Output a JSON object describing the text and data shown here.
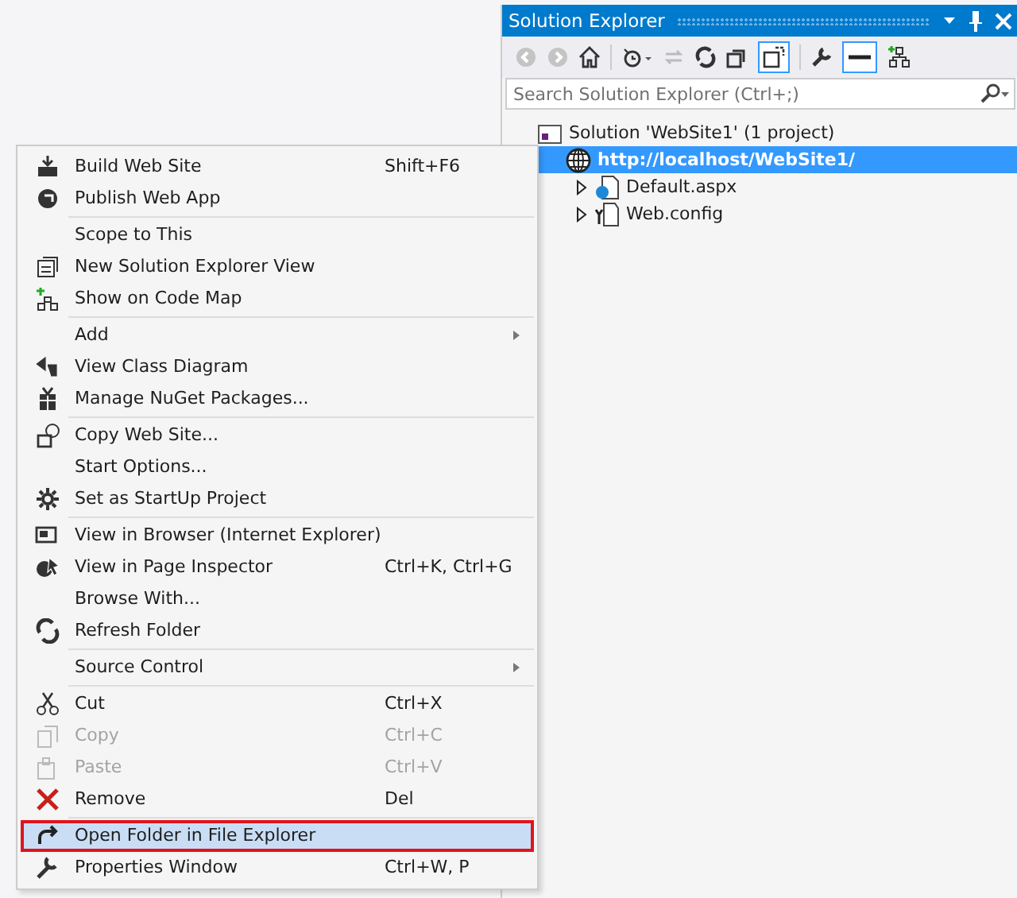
{
  "solution_explorer": {
    "title": "Solution Explorer",
    "search": {
      "placeholder": "Search Solution Explorer (Ctrl+;)"
    },
    "tree": [
      {
        "label": "Solution 'WebSite1' (1 project)",
        "selected": false,
        "children": [
          {
            "label": "http://localhost/WebSite1/",
            "selected": true,
            "children": [
              {
                "label": "Default.aspx",
                "selected": false,
                "expanded": false
              },
              {
                "label": "Web.config",
                "selected": false,
                "expanded": false
              }
            ]
          }
        ]
      }
    ]
  },
  "context_menu": {
    "groups": [
      [
        {
          "label": "Build Web Site",
          "shortcut": "Shift+F6",
          "disabled": false,
          "selected": false
        },
        {
          "label": "Publish Web App",
          "disabled": false,
          "selected": false
        }
      ],
      [
        {
          "label": "Scope to This",
          "disabled": false,
          "selected": false
        },
        {
          "label": "New Solution Explorer View",
          "disabled": false,
          "selected": false
        },
        {
          "label": "Show on Code Map",
          "disabled": false,
          "selected": false
        }
      ],
      [
        {
          "label": "Add",
          "submenu": true,
          "disabled": false,
          "selected": false
        },
        {
          "label": "View Class Diagram",
          "disabled": false,
          "selected": false
        },
        {
          "label": "Manage NuGet Packages...",
          "disabled": false,
          "selected": false
        }
      ],
      [
        {
          "label": "Copy Web Site...",
          "disabled": false,
          "selected": false
        },
        {
          "label": "Start Options...",
          "disabled": false,
          "selected": false
        },
        {
          "label": "Set as StartUp Project",
          "disabled": false,
          "selected": false
        }
      ],
      [
        {
          "label": "View in Browser (Internet Explorer)",
          "disabled": false,
          "selected": false
        },
        {
          "label": "View in Page Inspector",
          "shortcut": "Ctrl+K, Ctrl+G",
          "disabled": false,
          "selected": false
        },
        {
          "label": "Browse With...",
          "disabled": false,
          "selected": false
        },
        {
          "label": "Refresh Folder",
          "disabled": false,
          "selected": false
        }
      ],
      [
        {
          "label": "Source Control",
          "submenu": true,
          "disabled": false,
          "selected": false
        }
      ],
      [
        {
          "label": "Cut",
          "shortcut": "Ctrl+X",
          "disabled": false,
          "selected": false
        },
        {
          "label": "Copy",
          "shortcut": "Ctrl+C",
          "disabled": true,
          "selected": false
        },
        {
          "label": "Paste",
          "shortcut": "Ctrl+V",
          "disabled": true,
          "selected": false
        },
        {
          "label": "Remove",
          "shortcut": "Del",
          "disabled": false,
          "selected": false
        }
      ],
      [
        {
          "label": "Open Folder in File Explorer",
          "disabled": false,
          "selected": true
        },
        {
          "label": "Properties Window",
          "shortcut": "Ctrl+W, P",
          "disabled": false,
          "selected": false
        }
      ]
    ]
  }
}
